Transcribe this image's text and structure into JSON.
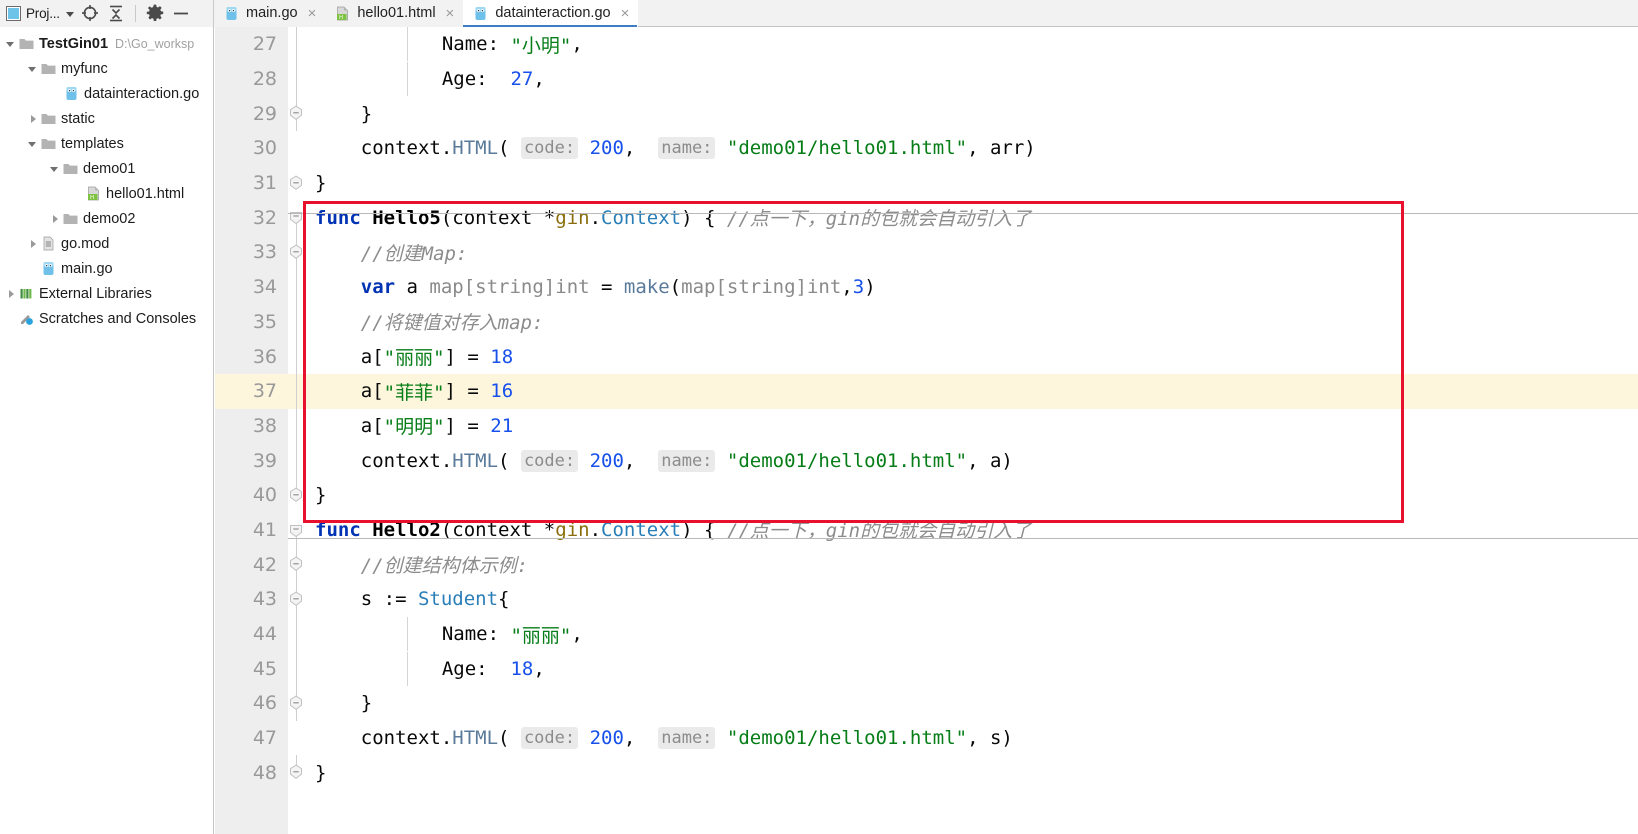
{
  "toolbar": {
    "project_label": "Proj...",
    "icons": [
      "project-swatch-icon",
      "chevron-down-icon",
      "locate-icon",
      "collapse-all-icon",
      "settings-gear-icon",
      "minimize-icon"
    ]
  },
  "tabs": [
    {
      "label": "main.go",
      "icon": "go-file-icon",
      "active": false,
      "close": "×"
    },
    {
      "label": "hello01.html",
      "icon": "html-file-icon",
      "active": false,
      "close": "×"
    },
    {
      "label": "datainteraction.go",
      "icon": "go-file-icon",
      "active": true,
      "close": "×"
    }
  ],
  "sidebar": {
    "items": [
      {
        "label": "TestGin01",
        "path": "D:\\Go_worksp",
        "icon": "folder-icon",
        "arrow": "down",
        "indent": 0,
        "bold": true
      },
      {
        "label": "myfunc",
        "path": "",
        "icon": "folder-icon",
        "arrow": "down",
        "indent": 1,
        "bold": false
      },
      {
        "label": "datainteraction.go",
        "path": "",
        "icon": "go-file-icon",
        "arrow": "none",
        "indent": 2,
        "bold": false
      },
      {
        "label": "static",
        "path": "",
        "icon": "folder-icon",
        "arrow": "right",
        "indent": 1,
        "bold": false
      },
      {
        "label": "templates",
        "path": "",
        "icon": "folder-icon",
        "arrow": "down",
        "indent": 1,
        "bold": false
      },
      {
        "label": "demo01",
        "path": "",
        "icon": "folder-icon",
        "arrow": "down",
        "indent": 2,
        "bold": false
      },
      {
        "label": "hello01.html",
        "path": "",
        "icon": "html-file-icon",
        "arrow": "none",
        "indent": 3,
        "bold": false
      },
      {
        "label": "demo02",
        "path": "",
        "icon": "folder-icon",
        "arrow": "right",
        "indent": 2,
        "bold": false
      },
      {
        "label": "go.mod",
        "path": "",
        "icon": "mod-file-icon",
        "arrow": "right",
        "indent": 1,
        "bold": false
      },
      {
        "label": "main.go",
        "path": "",
        "icon": "go-file-icon",
        "arrow": "none",
        "indent": 1,
        "bold": false
      },
      {
        "label": "External Libraries",
        "path": "",
        "icon": "libraries-icon",
        "arrow": "right",
        "indent": 0,
        "bold": false
      },
      {
        "label": "Scratches and Consoles",
        "path": "",
        "icon": "scratches-icon",
        "arrow": "none",
        "indent": 0,
        "bold": false
      }
    ]
  },
  "editor": {
    "file": "datainteraction.go",
    "first_line": 27,
    "highlight_line": 37,
    "annotation_box_color": "#e8112d",
    "highlight_color": "#fdf6dd",
    "lines": [
      {
        "n": 27,
        "text": "        Name: \"小明\","
      },
      {
        "n": 28,
        "text": "        Age:  27,"
      },
      {
        "n": 29,
        "text": "    }"
      },
      {
        "n": 30,
        "text": "    context.HTML( code: 200,  name: \"demo01/hello01.html\", arr)"
      },
      {
        "n": 31,
        "text": "}"
      },
      {
        "n": 32,
        "text": "func Hello5(context *gin.Context) { //点一下，gin的包就会自动引入了"
      },
      {
        "n": 33,
        "text": "    //创建Map:"
      },
      {
        "n": 34,
        "text": "    var a map[string]int = make(map[string]int,3)"
      },
      {
        "n": 35,
        "text": "    //将键值对存入map:"
      },
      {
        "n": 36,
        "text": "    a[\"丽丽\"] = 18"
      },
      {
        "n": 37,
        "text": "    a[\"菲菲\"] = 16"
      },
      {
        "n": 38,
        "text": "    a[\"明明\"] = 21"
      },
      {
        "n": 39,
        "text": "    context.HTML( code: 200,  name: \"demo01/hello01.html\", a)"
      },
      {
        "n": 40,
        "text": "}"
      },
      {
        "n": 41,
        "text": "func Hello2(context *gin.Context) { //点一下，gin的包就会自动引入了"
      },
      {
        "n": 42,
        "text": "    //创建结构体示例:"
      },
      {
        "n": 43,
        "text": "    s := Student{"
      },
      {
        "n": 44,
        "text": "        Name: \"丽丽\","
      },
      {
        "n": 45,
        "text": "        Age:  18,"
      },
      {
        "n": 46,
        "text": "    }"
      },
      {
        "n": 47,
        "text": "    context.HTML( code: 200,  name: \"demo01/hello01.html\", s)"
      },
      {
        "n": 48,
        "text": "}"
      }
    ],
    "tokens": {
      "kw_func": "func",
      "kw_var": "var",
      "fn_hello5": "Hello5",
      "fn_hello2": "Hello2",
      "type_context": "Context",
      "type_student": "Student",
      "pkg_gin": "gin",
      "builtin_make": "make",
      "method_html": "HTML",
      "param_hint_code": "code:",
      "param_hint_name": "name:",
      "status_code": "200",
      "map_size": "3",
      "values": [
        "18",
        "16",
        "21",
        "27"
      ],
      "template_path": "\"demo01/hello01.html\"",
      "names_cn": [
        "小明",
        "丽丽",
        "菲菲",
        "明明"
      ],
      "comment_autoimport": "//点一下，gin的包就会自动引入了",
      "comment_create_map": "//创建Map:",
      "comment_put_kv": "//将键值对存入map:",
      "comment_struct_demo": "//创建结构体示例:"
    }
  }
}
